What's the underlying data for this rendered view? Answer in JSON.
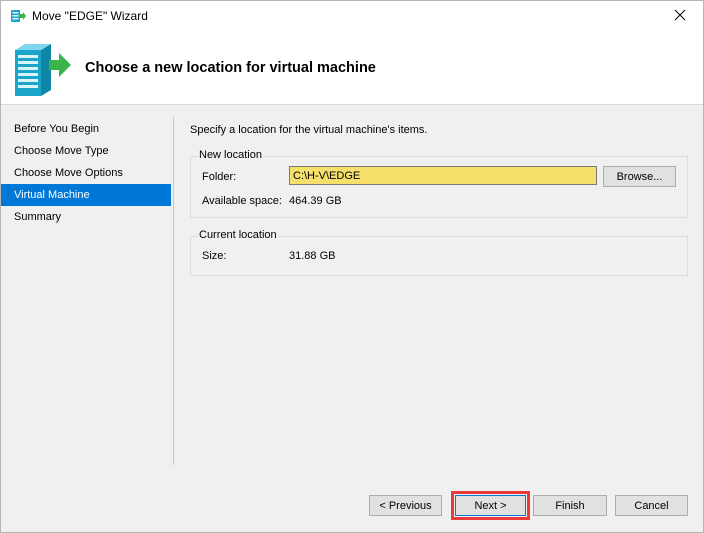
{
  "window": {
    "title": "Move \"EDGE\" Wizard"
  },
  "header": {
    "title": "Choose a new location for virtual machine"
  },
  "nav": {
    "items": [
      {
        "label": "Before You Begin"
      },
      {
        "label": "Choose Move Type"
      },
      {
        "label": "Choose Move Options"
      },
      {
        "label": "Virtual Machine",
        "selected": true
      },
      {
        "label": "Summary"
      }
    ]
  },
  "main": {
    "intro": "Specify a location for the virtual machine's items.",
    "new_location": {
      "legend": "New location",
      "folder_label": "Folder:",
      "folder_value": "C:\\H-V\\EDGE",
      "browse_label": "Browse...",
      "available_label": "Available space:",
      "available_value": "464.39 GB"
    },
    "current_location": {
      "legend": "Current location",
      "size_label": "Size:",
      "size_value": "31.88 GB"
    }
  },
  "footer": {
    "previous_label": "< Previous",
    "next_label": "Next >",
    "finish_label": "Finish",
    "cancel_label": "Cancel"
  },
  "colors": {
    "selection": "#0078d7",
    "folder_highlight": "#f7df6b",
    "annotation_box": "#ec3a3a"
  },
  "icons": {
    "title": "vm-move-icon",
    "header": "server-arrow-icon",
    "close": "close-icon"
  }
}
